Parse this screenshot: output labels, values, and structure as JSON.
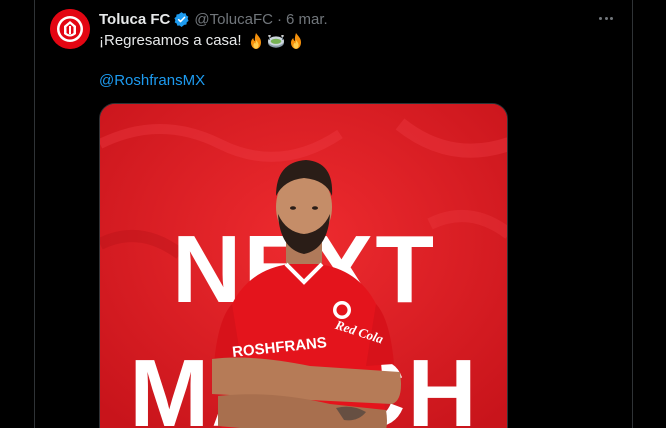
{
  "tweet": {
    "display_name": "Toluca FC",
    "handle": "@TolucaFC",
    "separator": "·",
    "date": "6 mar.",
    "text": "¡Regresamos a casa!",
    "mention": "@RoshfransMX",
    "emojis": [
      "fire-icon",
      "stadium-icon",
      "fire-icon"
    ],
    "verified": true
  },
  "media": {
    "poster_big_text_line1": "NEXT",
    "poster_big_text_line2": "MATCH",
    "jersey_sponsor": "ROSHFRANS",
    "sleeve_sponsor": "Red Cola",
    "background_color": "#e01a22"
  },
  "colors": {
    "background": "#000000",
    "text": "#e7e9ea",
    "secondary": "#71767b",
    "link": "#1d9bf0",
    "brand_red": "#e30613"
  }
}
